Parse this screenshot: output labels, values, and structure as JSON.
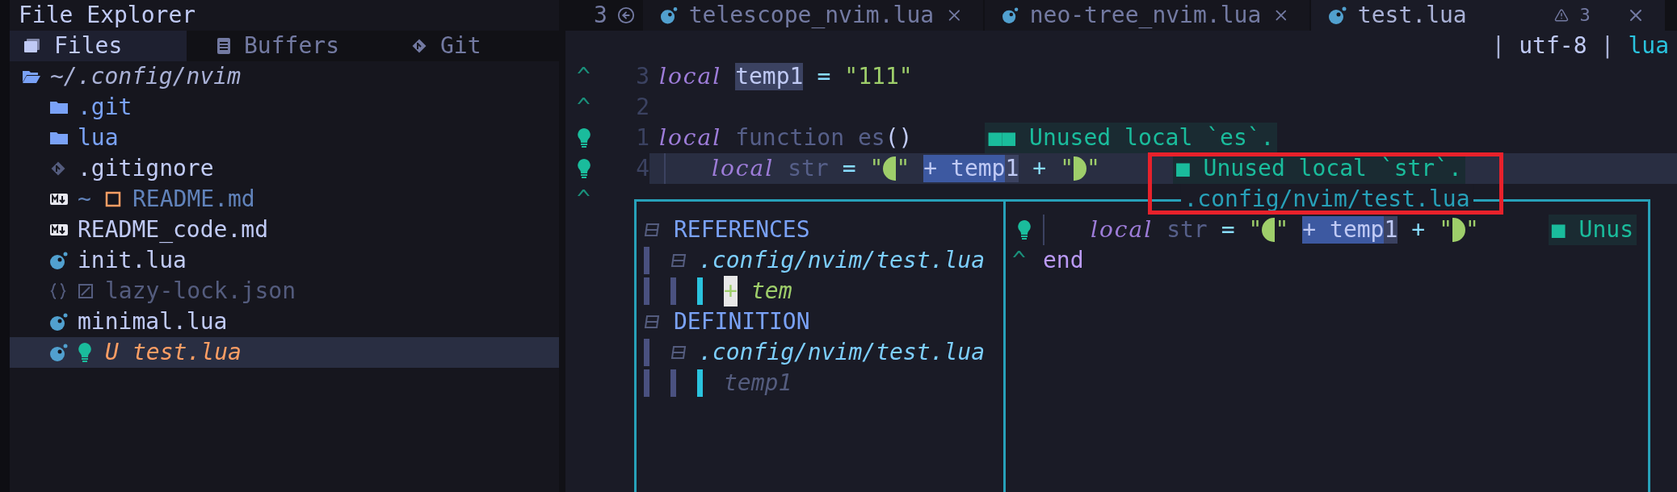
{
  "sidebar": {
    "title": "File Explorer",
    "tabs": [
      {
        "label": "Files",
        "kind": "files",
        "selected": true
      },
      {
        "label": "Buffers",
        "kind": "buffers",
        "selected": false
      },
      {
        "label": "Git",
        "kind": "git",
        "selected": false
      }
    ],
    "tree": {
      "label": "~/.config/nvim",
      "kind": "folder",
      "expanded": true,
      "children": [
        {
          "label": ".git",
          "kind": "folder",
          "expanded": false,
          "selected": false
        },
        {
          "label": "lua",
          "kind": "folder",
          "expanded": false,
          "selected": false
        },
        {
          "label": ".gitignore",
          "kind": "git",
          "selected": false
        },
        {
          "label": "README.md",
          "kind": "markdown",
          "git_sign": "~",
          "modified": true,
          "selected": false
        },
        {
          "label": "README_code.md",
          "kind": "markdown",
          "selected": false
        },
        {
          "label": "init.lua",
          "kind": "lua",
          "selected": false
        },
        {
          "label": "lazy-lock.json",
          "kind": "json",
          "ignored": true,
          "selected": false
        },
        {
          "label": "minimal.lua",
          "kind": "lua",
          "selected": false
        },
        {
          "label": "test.lua",
          "kind": "lua",
          "git_sign": "U",
          "untracked": true,
          "hint": true,
          "selected": true
        }
      ]
    }
  },
  "editor": {
    "buffer_count": "3",
    "tabs": [
      {
        "label": "telescope_nvim.lua",
        "selected": false
      },
      {
        "label": "neo-tree_nvim.lua",
        "selected": false
      },
      {
        "label": "test.lua",
        "selected": true,
        "warnings": "3"
      }
    ],
    "winbar": [
      {
        "text": "|",
        "kind": "separator"
      },
      {
        "text": "utf-8",
        "kind": "encoding"
      },
      {
        "text": "|",
        "kind": "separator"
      },
      {
        "text": "lua",
        "kind": "filetype"
      }
    ],
    "lines": [
      {
        "sign": {
          "kind": "caret",
          "text": "^"
        },
        "number": "3",
        "current": false,
        "words": [
          [
            {
              "text": "local",
              "kind": "keyword"
            }
          ],
          [
            {
              "text": "temp1",
              "kind": "reference"
            }
          ],
          [
            {
              "text": "=",
              "kind": "operator"
            }
          ],
          [
            {
              "text": "\"111\"",
              "kind": "string"
            }
          ]
        ]
      },
      {
        "sign": {
          "kind": "caret",
          "text": "^"
        },
        "number": "2",
        "current": false
      },
      {
        "sign": {
          "kind": "hint"
        },
        "number": "1",
        "current": false,
        "words": [
          [
            {
              "text": "local",
              "kind": "keyword"
            }
          ],
          [
            {
              "text": "function",
              "kind": "dim"
            }
          ],
          [
            {
              "text": "es",
              "kind": "dim"
            },
            {
              "text": "()",
              "kind": "punct"
            }
          ]
        ],
        "virtual_text": "■■ Unused local `es`."
      },
      {
        "sign": {
          "kind": "hint"
        },
        "number": "4",
        "current": true,
        "words": [
          [
            {
              "kind": "guide"
            }
          ],
          [
            {
              "text": "local",
              "kind": "keyword"
            }
          ],
          [
            {
              "text": "str",
              "kind": "dim"
            }
          ],
          [
            {
              "text": "=",
              "kind": "operator"
            }
          ],
          [
            {
              "text": "\"",
              "kind": "string"
            },
            {
              "kind": "open"
            },
            {
              "text": "\"",
              "kind": "string"
            }
          ],
          [
            {
              "text": "+ temp",
              "kind": "selection"
            },
            {
              "text": "1",
              "kind": "reference"
            }
          ],
          [
            {
              "text": "+",
              "kind": "operator"
            }
          ],
          [
            {
              "text": "\"",
              "kind": "string"
            },
            {
              "kind": "close"
            },
            {
              "text": "\"",
              "kind": "string"
            }
          ]
        ],
        "virtual_text": "■ Unused local `str`."
      },
      {
        "sign": {
          "kind": "caret",
          "text": "^"
        },
        "current": false
      }
    ],
    "peek": {
      "title": ".config/nvim/test.lua",
      "sections": [
        {
          "label": "REFERENCES",
          "expanded": true,
          "files": [
            {
              "label": ".config/nvim/test.lua",
              "expanded": true,
              "matches": [
                {
                  "text": "tem",
                  "cursor": "+",
                  "selected": true
                }
              ]
            }
          ]
        },
        {
          "label": "DEFINITION",
          "expanded": true,
          "files": [
            {
              "label": ".config/nvim/test.lua",
              "expanded": true,
              "matches": [
                {
                  "text": "temp1",
                  "selected": false
                }
              ]
            }
          ]
        }
      ],
      "preview": [
        {
          "sign": {
            "kind": "hint"
          },
          "words": [
            [
              {
                "kind": "guide"
              }
            ],
            [
              {
                "text": "local",
                "kind": "keyword"
              }
            ],
            [
              {
                "text": "str",
                "kind": "dim"
              }
            ],
            [
              {
                "text": "=",
                "kind": "operator"
              }
            ],
            [
              {
                "text": "\"",
                "kind": "string"
              },
              {
                "kind": "open"
              },
              {
                "text": "\"",
                "kind": "string"
              }
            ],
            [
              {
                "text": "+ temp",
                "kind": "selection"
              },
              {
                "text": "1",
                "kind": "reference"
              }
            ],
            [
              {
                "text": "+",
                "kind": "operator"
              }
            ],
            [
              {
                "text": "\"",
                "kind": "string"
              },
              {
                "kind": "close"
              },
              {
                "text": "\"",
                "kind": "string"
              }
            ]
          ],
          "virtual_text": "■ Unus"
        },
        {
          "sign": {
            "kind": "caret",
            "text": "^"
          },
          "words": [
            [
              {
                "text": "end",
                "kind": "keyword-plain"
              }
            ]
          ]
        }
      ]
    }
  }
}
